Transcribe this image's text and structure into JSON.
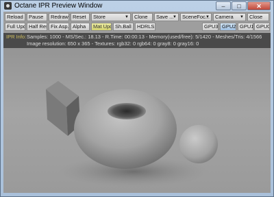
{
  "window": {
    "title": "Octane IPR Preview Window"
  },
  "toolbar1": [
    {
      "label": "Reload",
      "name": "reload-button"
    },
    {
      "label": "Pause",
      "name": "pause-button"
    },
    {
      "label": "Redraw",
      "name": "redraw-button"
    },
    {
      "label": "Reset",
      "name": "reset-button"
    },
    {
      "label": "Store",
      "name": "store-dropdown"
    },
    {
      "label": "Clone",
      "name": "clone-button"
    },
    {
      "label": "Save ...",
      "name": "save-dropdown"
    },
    {
      "label": "SceneFoc...",
      "name": "scene-focus-dropdown"
    },
    {
      "label": "Camera",
      "name": "camera-dropdown"
    },
    {
      "label": "Close",
      "name": "close-button"
    }
  ],
  "toolbar2": [
    {
      "label": "Full Upd",
      "name": "full-update-button"
    },
    {
      "label": "Half Res",
      "name": "half-res-button"
    },
    {
      "label": "Fix Asp.",
      "name": "fix-aspect-button"
    },
    {
      "label": "Alpha",
      "name": "alpha-button"
    },
    {
      "label": "Mat Upd",
      "name": "mat-update-button"
    },
    {
      "label": "Sh.Ball",
      "name": "shader-ball-button"
    },
    {
      "label": "HDRLS",
      "name": "hdrls-button"
    },
    {
      "label": "GPU3",
      "name": "gpu3-button"
    },
    {
      "label": "GPU2",
      "name": "gpu2-button"
    },
    {
      "label": "GPU1",
      "name": "gpu1-button"
    },
    {
      "label": "GPU0",
      "name": "gpu0-button"
    }
  ],
  "info": {
    "label": "IPR Info:",
    "line1": "Samples: 1000 - MS/Sec.: 18.13 - R.Time: 00:00:13 - Memory(used/free): 5/1420 - Meshes/Tris: 4/1566",
    "line2": "Image resolution: 650 x 365 - Textures: rgb32: 0  rgb64: 0  gray8: 0  gray16: 0"
  }
}
